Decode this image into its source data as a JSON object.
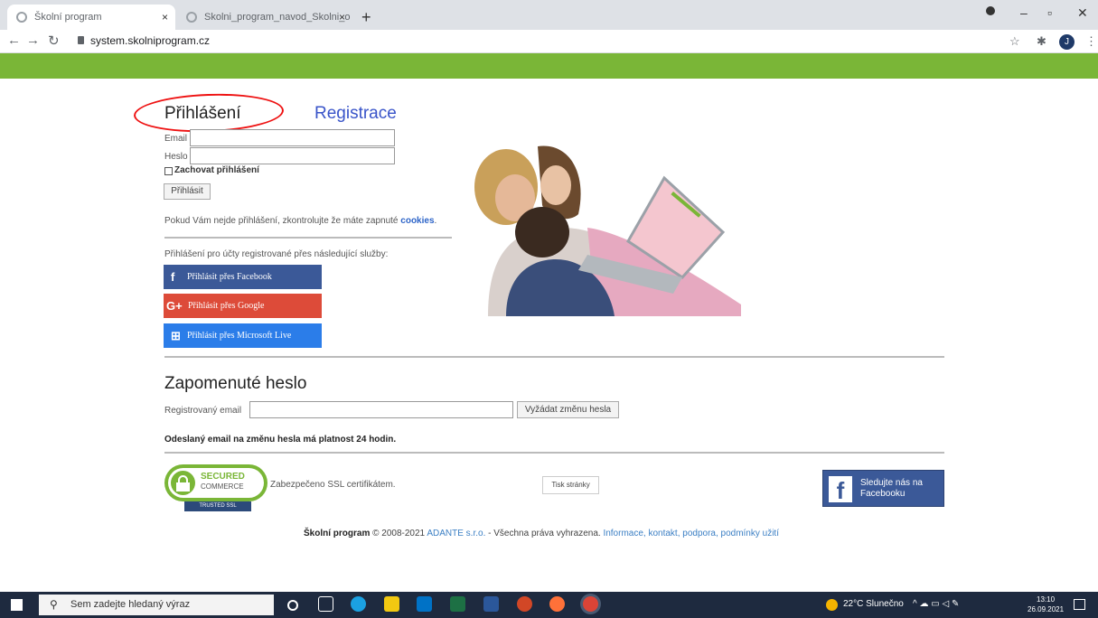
{
  "browser": {
    "tabs": [
      {
        "title": "Školní program",
        "close": "×"
      },
      {
        "title": "Skolni_program_navod_Skolni_o",
        "close": "×"
      }
    ],
    "new_tab": "+",
    "url": "system.skolniprogram.cz",
    "avatar_letter": "J"
  },
  "login": {
    "title": "Přihlášení",
    "register_link": "Registrace",
    "email_label": "Email",
    "password_label": "Heslo",
    "remember_label": "Zachovat přihlášení",
    "submit_label": "Přihlásit",
    "note_text": "Pokud Vám nejde přihlášení, zkontrolujte že máte zapnuté",
    "note_link": "cookies",
    "note_end": "."
  },
  "social": {
    "caption": "Přihlášení pro účty registrované přes následující služby:",
    "buttons": [
      {
        "label": "Přihlásit přes Facebook",
        "icon": "f",
        "color": "#3b5998"
      },
      {
        "label": "Přihlásit přes Google",
        "icon": "G+",
        "color": "#dd4b39"
      },
      {
        "label": "Přihlásit přes Microsoft Live",
        "icon": "⊞",
        "color": "#2b7de9"
      }
    ]
  },
  "forgot": {
    "title": "Zapomenuté heslo",
    "email_label": "Registrovaný email",
    "submit_label": "Vyžádat změnu hesla",
    "validity_note": "Odeslaný email na změnu hesla má platnost 24 hodin."
  },
  "security": {
    "badge_line1": "SECURED",
    "badge_line2": "COMMERCE",
    "badge_line3": "TRUSTED SSL",
    "ssl_text": "Zabezpečeno SSL certifikátem.",
    "print_label": "Tisk stránky",
    "fb_follow": "Sledujte nás na Facebooku"
  },
  "footer": {
    "brand": "Školní program",
    "copyright": "© 2008-2021",
    "company": "ADANTE s.r.o.",
    "rights": "- Všechna práva vyhrazena.",
    "links": "Informace, kontakt, podpora, podmínky užití"
  },
  "taskbar": {
    "search_placeholder": "Sem zadejte hledaný výraz",
    "weather": "22°C Slunečno",
    "time": "13:10",
    "date": "26.09.2021"
  },
  "colors": {
    "accent_green": "#7ab637",
    "link_blue": "#3954c9"
  }
}
